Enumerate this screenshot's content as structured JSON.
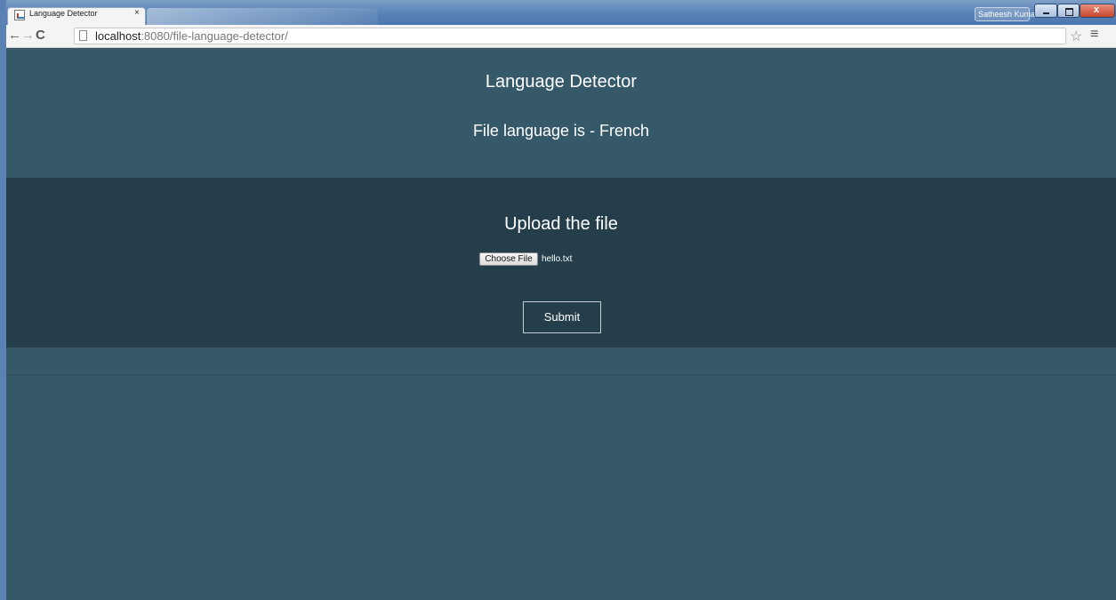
{
  "browser": {
    "tab_title": "Language Detector",
    "tab_close": "×",
    "profile_name": "Satheesh Kumar",
    "close_glyph": "x",
    "url_host": "localhost",
    "url_path": ":8080/file-language-detector/",
    "back_glyph": "←",
    "forward_glyph": "→",
    "reload_glyph": "C",
    "star_glyph": "☆",
    "menu_glyph": "≡"
  },
  "page": {
    "title": "Language Detector",
    "result_text": "File language is - French",
    "upload_title": "Upload the file",
    "choose_file_label": "Choose File",
    "file_name": "hello.txt",
    "submit_label": "Submit"
  },
  "colors": {
    "header_bg": "#36596a",
    "upload_bg": "#243f4b",
    "text": "#ffffff"
  }
}
